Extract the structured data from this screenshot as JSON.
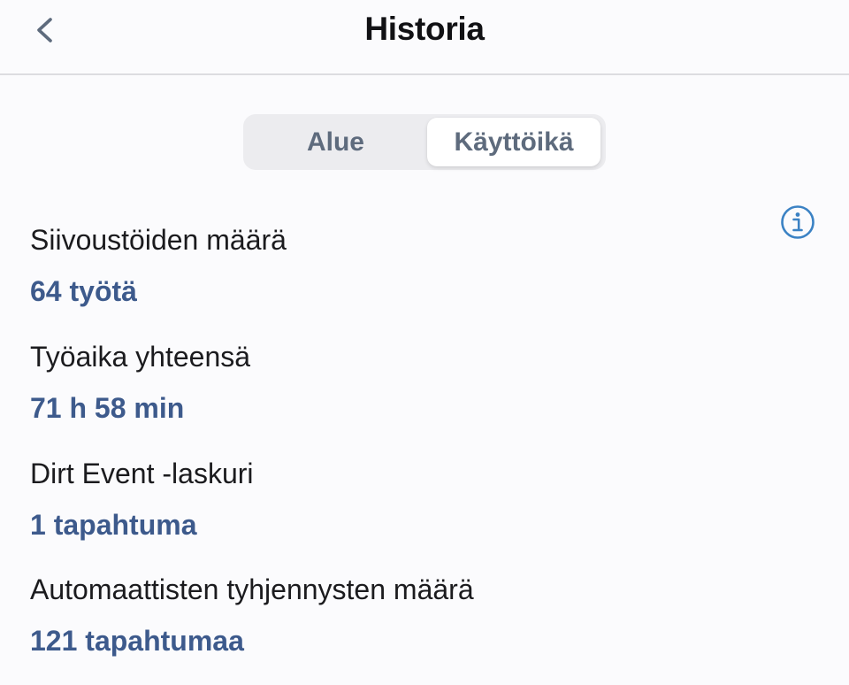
{
  "header": {
    "title": "Historia",
    "back_icon": "chevron-left-icon"
  },
  "tabs": [
    {
      "label": "Alue",
      "selected": false
    },
    {
      "label": "Käyttöikä",
      "selected": true
    }
  ],
  "info_icon": "info-circle-icon",
  "stats": [
    {
      "label": "Siivoustöiden määrä",
      "value": "64 työtä"
    },
    {
      "label": "Työaika yhteensä",
      "value": "71 h 58 min"
    },
    {
      "label": "Dirt Event -laskuri",
      "value": "1 tapahtuma"
    },
    {
      "label": "Automaattisten tyhjennysten määrä",
      "value": "121 tapahtumaa"
    }
  ],
  "colors": {
    "accent_value": "#3d5a8c",
    "segment_text": "#5e6b7d",
    "info_icon": "#3b82c4",
    "back_icon": "#5e6b7d"
  }
}
